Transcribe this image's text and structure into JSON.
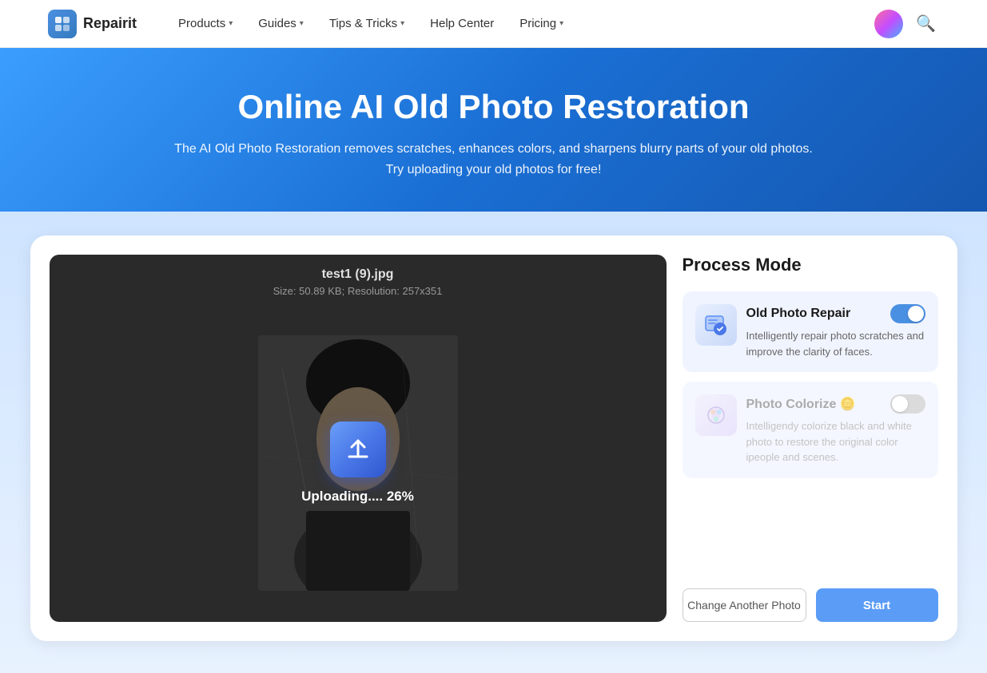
{
  "navbar": {
    "logo_icon": "R",
    "logo_text": "Repairit",
    "nav_items": [
      {
        "label": "Products",
        "has_dropdown": true
      },
      {
        "label": "Guides",
        "has_dropdown": true
      },
      {
        "label": "Tips & Tricks",
        "has_dropdown": true
      },
      {
        "label": "Help Center",
        "has_dropdown": false
      },
      {
        "label": "Pricing",
        "has_dropdown": true
      }
    ]
  },
  "hero": {
    "title": "Online AI Old Photo Restoration",
    "subtitle": "The AI Old Photo Restoration removes scratches, enhances colors, and sharpens blurry parts of your old photos. Try uploading your old photos for free!"
  },
  "photo": {
    "filename": "test1 (9).jpg",
    "meta": "Size: 50.89 KB; Resolution: 257x351",
    "upload_text": "Uploading.... 26%"
  },
  "process": {
    "title": "Process Mode",
    "modes": [
      {
        "label": "Old Photo Repair",
        "enabled": true,
        "description": "Intelligently repair photo scratches and improve the clarity of faces.",
        "premium": false
      },
      {
        "label": "Photo Colorize",
        "enabled": false,
        "description": "Intelligendy colorize black and white photo to restore the original color ipeople and scenes.",
        "premium": true
      }
    ]
  },
  "buttons": {
    "change_photo": "Change Another Photo",
    "start": "Start"
  }
}
